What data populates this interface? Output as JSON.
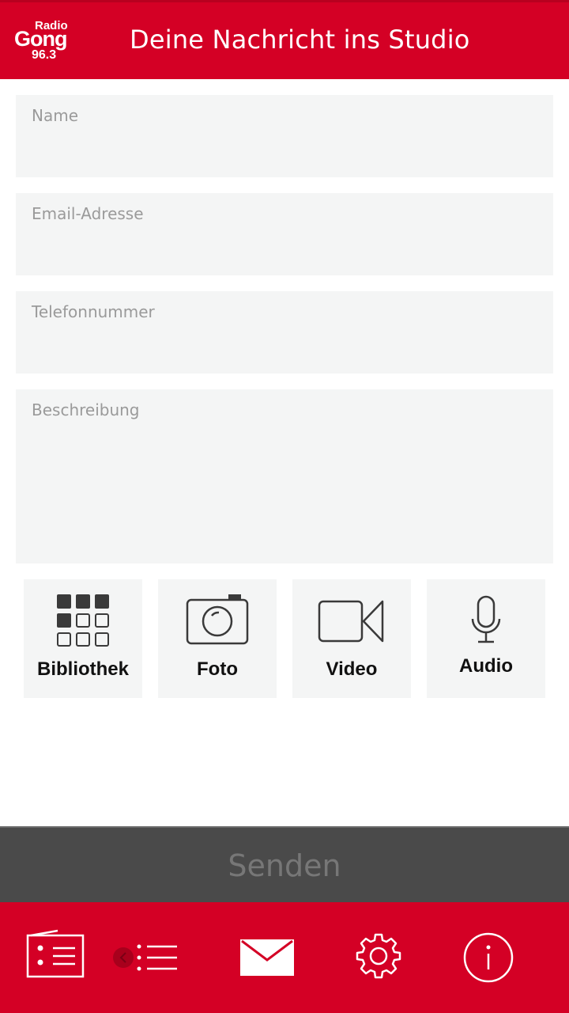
{
  "header": {
    "logo": {
      "line1": "Radio",
      "line2": "Gong",
      "line3": "96.3"
    },
    "title": "Deine Nachricht ins Studio"
  },
  "form": {
    "name_placeholder": "Name",
    "email_placeholder": "Email-Adresse",
    "phone_placeholder": "Telefonnummer",
    "description_placeholder": "Beschreibung"
  },
  "media": {
    "library_label": "Bibliothek",
    "photo_label": "Foto",
    "video_label": "Video",
    "audio_label": "Audio"
  },
  "send": {
    "label": "Senden"
  },
  "nav": {
    "items": [
      "radio-icon",
      "playlist-icon",
      "mail-icon",
      "settings-icon",
      "info-icon"
    ],
    "active": "mail-icon"
  },
  "colors": {
    "brand_red": "#d40025",
    "field_bg": "#f4f5f5",
    "send_bar": "#4a4a4a",
    "placeholder_text": "#9a9a9a"
  }
}
